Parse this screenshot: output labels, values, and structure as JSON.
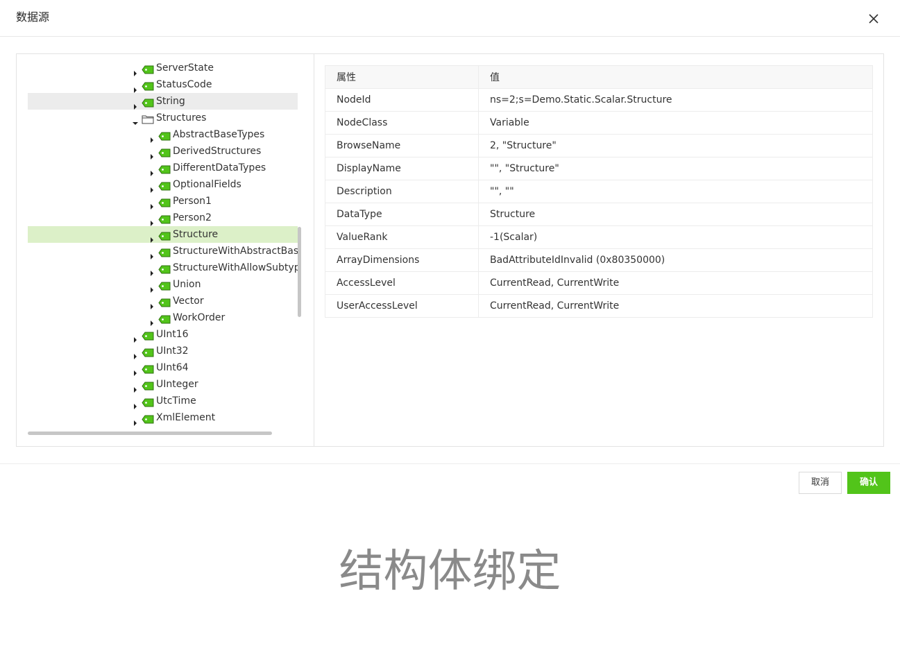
{
  "dialog": {
    "title": "数据源",
    "cancel_label": "取消",
    "confirm_label": "确认",
    "accent_color": "#52c41a"
  },
  "tree": {
    "items": [
      {
        "label": "ServerState",
        "level": 1,
        "icon": "tag-icon",
        "expanded": false
      },
      {
        "label": "StatusCode",
        "level": 1,
        "icon": "tag-icon",
        "expanded": false
      },
      {
        "label": "String",
        "level": 1,
        "icon": "tag-icon",
        "expanded": false,
        "state": "hover"
      },
      {
        "label": "Structures",
        "level": 1,
        "icon": "folder-open-icon",
        "expanded": true
      },
      {
        "label": "AbstractBaseTypes",
        "level": 2,
        "icon": "tag-icon",
        "expanded": false
      },
      {
        "label": "DerivedStructures",
        "level": 2,
        "icon": "tag-icon",
        "expanded": false
      },
      {
        "label": "DifferentDataTypes",
        "level": 2,
        "icon": "tag-icon",
        "expanded": false
      },
      {
        "label": "OptionalFields",
        "level": 2,
        "icon": "tag-icon",
        "expanded": false
      },
      {
        "label": "Person1",
        "level": 2,
        "icon": "tag-icon",
        "expanded": false
      },
      {
        "label": "Person2",
        "level": 2,
        "icon": "tag-icon",
        "expanded": false
      },
      {
        "label": "Structure",
        "level": 2,
        "icon": "tag-icon",
        "expanded": false,
        "state": "selected"
      },
      {
        "label": "StructureWithAbstractBase",
        "level": 2,
        "icon": "tag-icon",
        "expanded": false
      },
      {
        "label": "StructureWithAllowSubtype",
        "level": 2,
        "icon": "tag-icon",
        "expanded": false
      },
      {
        "label": "Union",
        "level": 2,
        "icon": "tag-icon",
        "expanded": false
      },
      {
        "label": "Vector",
        "level": 2,
        "icon": "tag-icon",
        "expanded": false
      },
      {
        "label": "WorkOrder",
        "level": 2,
        "icon": "tag-icon",
        "expanded": false
      },
      {
        "label": "UInt16",
        "level": 1,
        "icon": "tag-icon",
        "expanded": false
      },
      {
        "label": "UInt32",
        "level": 1,
        "icon": "tag-icon",
        "expanded": false
      },
      {
        "label": "UInt64",
        "level": 1,
        "icon": "tag-icon",
        "expanded": false
      },
      {
        "label": "UInteger",
        "level": 1,
        "icon": "tag-icon",
        "expanded": false
      },
      {
        "label": "UtcTime",
        "level": 1,
        "icon": "tag-icon",
        "expanded": false
      },
      {
        "label": "XmlElement",
        "level": 1,
        "icon": "tag-icon",
        "expanded": false
      }
    ],
    "icon_color": "#52c41a"
  },
  "properties": {
    "headers": [
      "属性",
      "值"
    ],
    "rows": [
      [
        "NodeId",
        "ns=2;s=Demo.Static.Scalar.Structure"
      ],
      [
        "NodeClass",
        "Variable"
      ],
      [
        "BrowseName",
        "2, \"Structure\""
      ],
      [
        "DisplayName",
        "\"\", \"Structure\""
      ],
      [
        "Description",
        "\"\", \"\""
      ],
      [
        "DataType",
        "Structure"
      ],
      [
        "ValueRank",
        "-1(Scalar)"
      ],
      [
        "ArrayDimensions",
        "BadAttributeIdInvalid (0x80350000)"
      ],
      [
        "AccessLevel",
        "CurrentRead, CurrentWrite"
      ],
      [
        "UserAccessLevel",
        "CurrentRead, CurrentWrite"
      ]
    ]
  },
  "caption": "结构体绑定"
}
